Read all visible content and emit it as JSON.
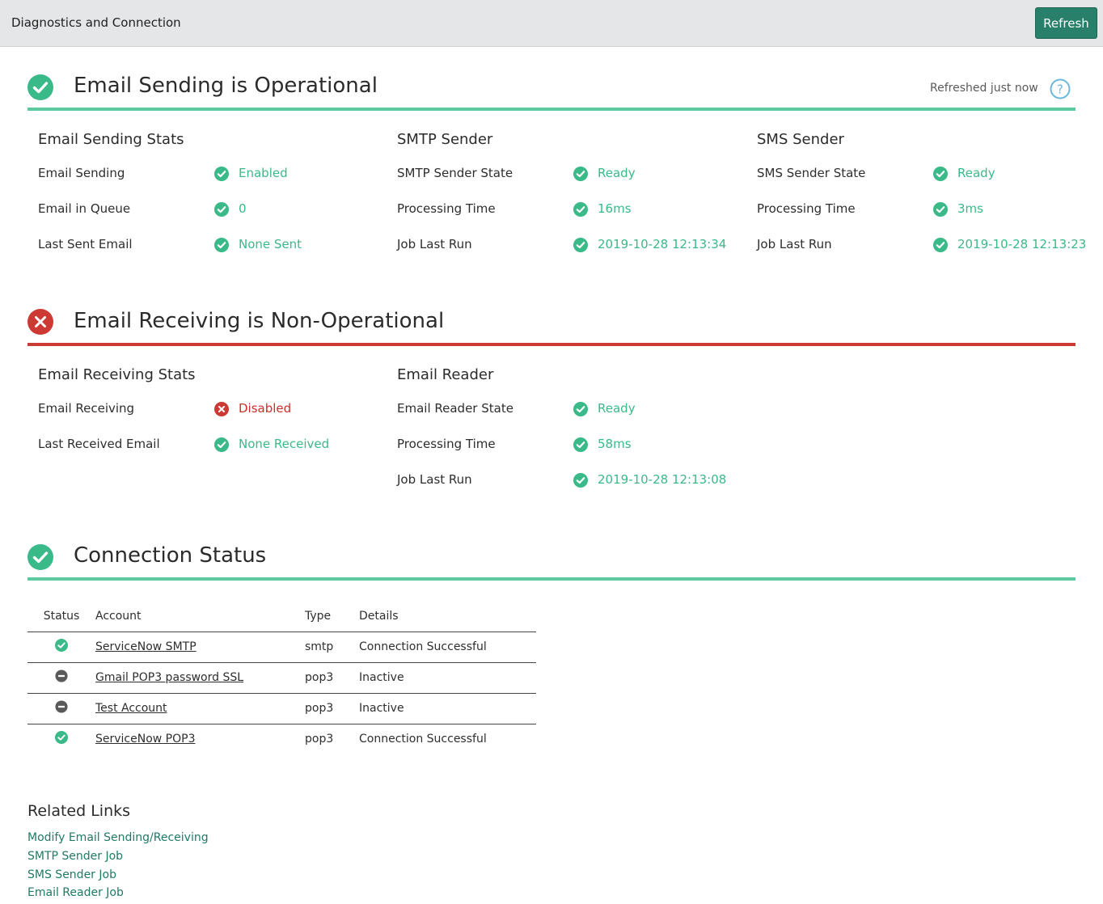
{
  "header": {
    "title": "Diagnostics and Connection",
    "refresh_label": "Refresh"
  },
  "colors": {
    "green": "#3ab989",
    "red": "#c9302c",
    "brand": "#29806a"
  },
  "sending": {
    "title": "Email Sending is Operational",
    "status": "ok",
    "refreshed": "Refreshed just now",
    "groups": [
      {
        "title": "Email Sending Stats",
        "rows": [
          {
            "label": "Email Sending",
            "value": "Enabled",
            "status": "ok"
          },
          {
            "label": "Email in Queue",
            "value": "0",
            "status": "ok"
          },
          {
            "label": "Last Sent Email",
            "value": "None Sent",
            "status": "ok"
          }
        ]
      },
      {
        "title": "SMTP Sender",
        "rows": [
          {
            "label": "SMTP Sender State",
            "value": "Ready",
            "status": "ok"
          },
          {
            "label": "Processing Time",
            "value": "16ms",
            "status": "ok"
          },
          {
            "label": "Job Last Run",
            "value": "2019-10-28 12:13:34",
            "status": "ok"
          }
        ]
      },
      {
        "title": "SMS Sender",
        "rows": [
          {
            "label": "SMS Sender State",
            "value": "Ready",
            "status": "ok"
          },
          {
            "label": "Processing Time",
            "value": "3ms",
            "status": "ok"
          },
          {
            "label": "Job Last Run",
            "value": "2019-10-28 12:13:23",
            "status": "ok"
          }
        ]
      }
    ]
  },
  "receiving": {
    "title": "Email Receiving is Non-Operational",
    "status": "error",
    "groups": [
      {
        "title": "Email Receiving Stats",
        "rows": [
          {
            "label": "Email Receiving",
            "value": "Disabled",
            "status": "error"
          },
          {
            "label": "Last Received Email",
            "value": "None Received",
            "status": "ok"
          }
        ]
      },
      {
        "title": "Email Reader",
        "rows": [
          {
            "label": "Email Reader State",
            "value": "Ready",
            "status": "ok"
          },
          {
            "label": "Processing Time",
            "value": "58ms",
            "status": "ok"
          },
          {
            "label": "Job Last Run",
            "value": "2019-10-28 12:13:08",
            "status": "ok"
          }
        ]
      }
    ]
  },
  "connection": {
    "title": "Connection Status",
    "status": "ok",
    "columns": [
      "Status",
      "Account",
      "Type",
      "Details"
    ],
    "rows": [
      {
        "status": "ok",
        "account": "ServiceNow SMTP",
        "type": "smtp",
        "details": "Connection Successful"
      },
      {
        "status": "inactive",
        "account": "Gmail POP3 password SSL",
        "type": "pop3",
        "details": "Inactive"
      },
      {
        "status": "inactive",
        "account": "Test Account",
        "type": "pop3",
        "details": "Inactive"
      },
      {
        "status": "ok",
        "account": "ServiceNow POP3",
        "type": "pop3",
        "details": "Connection Successful"
      }
    ]
  },
  "related": {
    "title": "Related Links",
    "links": [
      "Modify Email Sending/Receiving",
      "SMTP Sender Job",
      "SMS Sender Job",
      "Email Reader Job"
    ]
  }
}
